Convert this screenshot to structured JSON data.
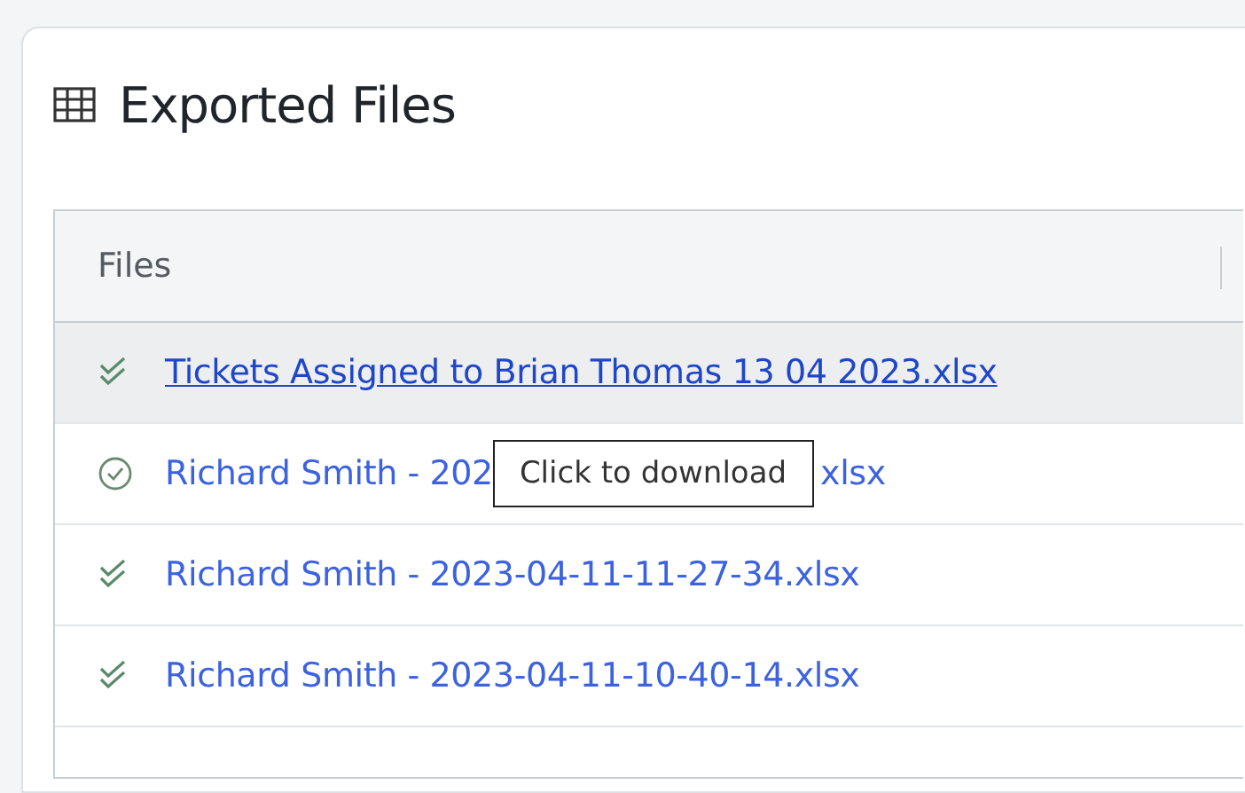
{
  "panel": {
    "title": "Exported Files"
  },
  "table": {
    "columns": [
      "Files"
    ],
    "rows": [
      {
        "kind": "double-check",
        "name": "Tickets Assigned to Brian Thomas 13 04 2023.xlsx",
        "hovered": true
      },
      {
        "kind": "circle-check",
        "name": "Richard Smith - 202",
        "name_tail": "xlsx",
        "hovered": false
      },
      {
        "kind": "double-check",
        "name": "Richard Smith - 2023-04-11-11-27-34.xlsx",
        "hovered": false
      },
      {
        "kind": "double-check",
        "name": "Richard Smith - 2023-04-11-10-40-14.xlsx",
        "hovered": false
      }
    ]
  },
  "tooltip": {
    "text": "Click to download"
  }
}
